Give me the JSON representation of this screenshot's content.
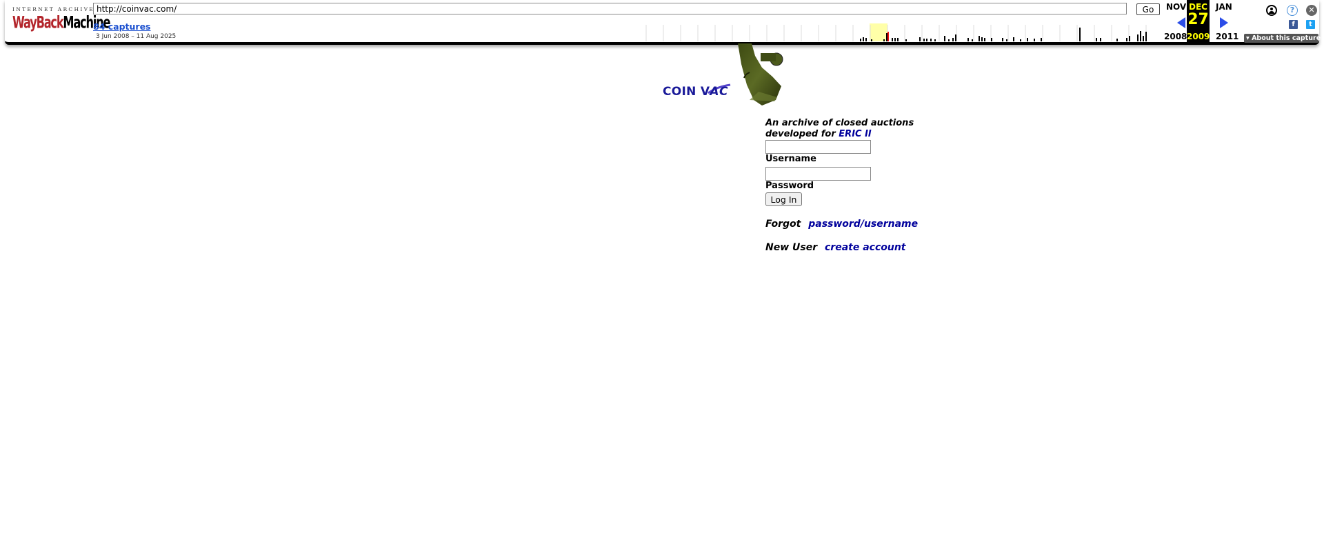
{
  "wayback": {
    "logo_top": "INTERNET ARCHIVE",
    "logo_main_a": "Way",
    "logo_main_b": "Back",
    "logo_main_c": "Machine",
    "url": "http://coinvac.com/",
    "go_label": "Go",
    "captures_link": "84 captures",
    "date_range": "3 Jun 2008 – 11 Aug 2025",
    "prev_month": "NOV",
    "current_month": "DEC",
    "next_month": "JAN",
    "current_day": "27",
    "prev_year": "2008",
    "current_year": "2009",
    "next_year": "2011",
    "about_capture": "▾ About this capture",
    "icons": {
      "user": "user-account-icon",
      "help": "help-icon",
      "close": "close-icon",
      "facebook": "facebook-icon",
      "twitter": "twitter-icon"
    },
    "help_glyph": "?",
    "close_glyph": "✕",
    "facebook_glyph": "f",
    "twitter_glyph": "t"
  },
  "site": {
    "logo_word_a": "COIN V",
    "logo_word_b": "AC",
    "tagline_line1": "An archive of closed auctions",
    "tagline_line2": "developed for",
    "tagline_link": "ERIC II",
    "username_label": "Username",
    "password_label": "Password",
    "login_button": "Log In",
    "forgot_label": "Forgot",
    "forgot_link": "password/username",
    "new_user_label": "New User",
    "create_account_link": "create account"
  },
  "colors": {
    "link_blue": "#00009c",
    "wayback_yellow": "#ffff00",
    "wayback_red": "#b3252b"
  }
}
